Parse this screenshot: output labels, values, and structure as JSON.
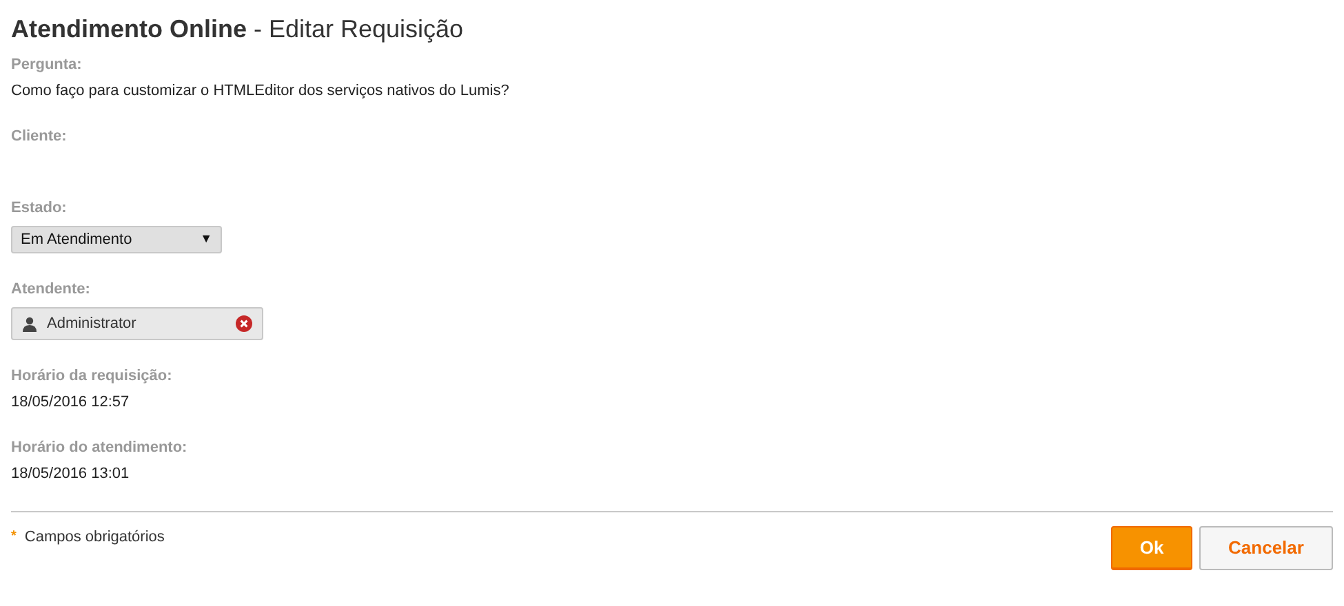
{
  "title": "**Atendimento Online** - Editar Requisição",
  "fields": [
    {
      "kind": "text",
      "label": "Pergunta:",
      "value": "Como faço para customizar o HTMLEditor dos serviços nativos do Lumis?"
    },
    {
      "kind": "text",
      "label": "Cliente:"
    },
    {
      "kind": "select",
      "label": "Estado:",
      "value": "Em Atendimento",
      "arrow": "▼"
    },
    {
      "kind": "user",
      "label": "Atendente:",
      "value": "Administrator"
    },
    {
      "kind": "text",
      "label": "Horário da requisição:",
      "value": "18/05/2016 12:57"
    },
    {
      "kind": "text",
      "label": "Horário do atendimento:",
      "value": "18/05/2016 13:01"
    }
  ],
  "footer": {
    "required_mark": "*",
    "required_note": "Campos obrigatórios"
  },
  "buttons": [
    {
      "kind": "primary",
      "label": "Ok"
    },
    {
      "kind": "secondary",
      "label": "Cancelar"
    }
  ]
}
